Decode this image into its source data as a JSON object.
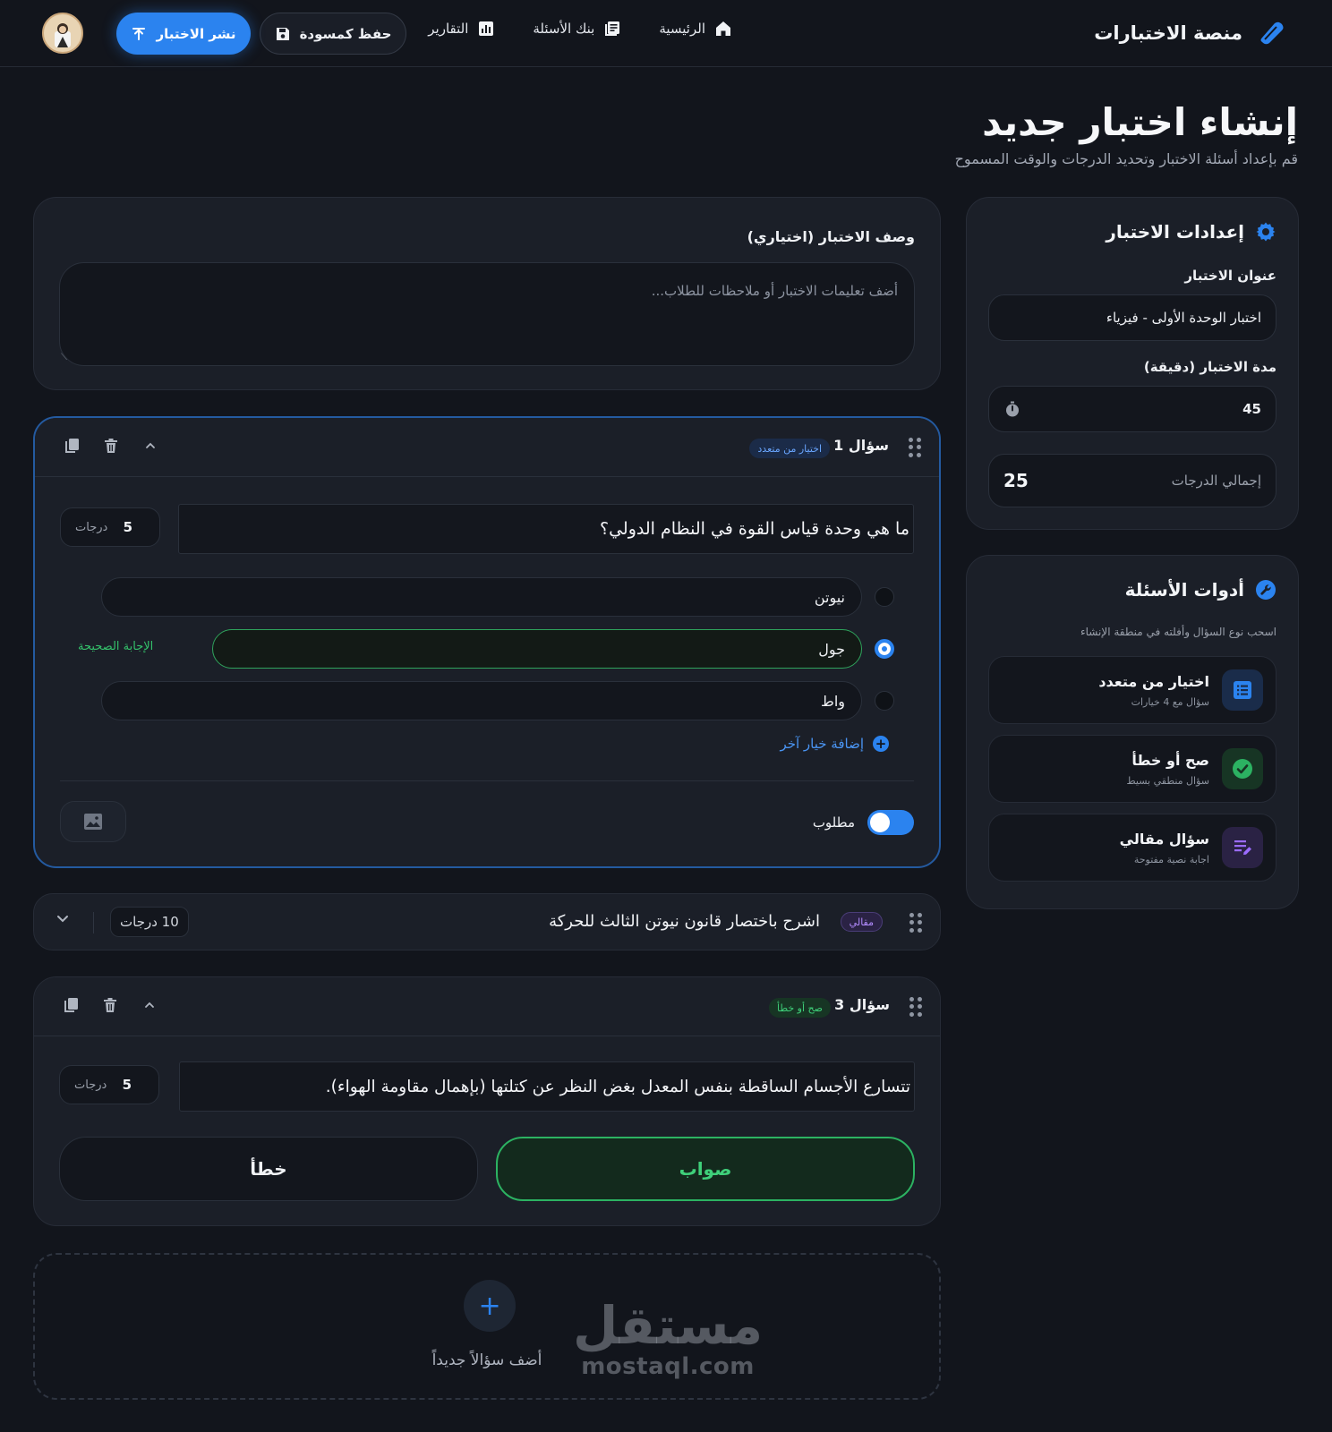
{
  "nav": {
    "brand": "منصة الاختبارات",
    "links": [
      {
        "label": "الرئيسية",
        "icon": "home-icon"
      },
      {
        "label": "بنك الأسئلة",
        "icon": "question-bank-icon"
      },
      {
        "label": "التقارير",
        "icon": "reports-icon"
      }
    ],
    "save_draft": "حفظ كمسودة",
    "publish": "نشر الاختبار"
  },
  "header": {
    "title": "إنشاء اختبار جديد",
    "subtitle": "قم بإعداد أسئلة الاختبار وتحديد الدرجات والوقت المسموح"
  },
  "description": {
    "label": "وصف الاختبار (اختياري)",
    "placeholder": "أضف تعليمات الاختبار أو ملاحظات للطلاب..."
  },
  "questions": [
    {
      "title": "سؤال 1",
      "type_badge": "اختيار من متعدد",
      "text": "ما هي وحدة قياس القوة في النظام الدولي؟",
      "score": "5",
      "score_unit": "درجات",
      "options": [
        {
          "label": "نيوتن",
          "correct": false
        },
        {
          "label": "جول",
          "correct": true
        },
        {
          "label": "واط",
          "correct": false
        }
      ],
      "correct_tag": "الإجابة الصحيحة",
      "add_option": "إضافة خيار آخر",
      "required_label": "مطلوب",
      "required": true
    },
    {
      "type_badge": "مقالي",
      "text": "اشرح باختصار قانون نيوتن الثالث للحركة",
      "score_label": "10 درجات"
    },
    {
      "title": "سؤال 3",
      "type_badge": "صح أو خطأ",
      "text": "تتسارع الأجسام الساقطة بنفس المعدل بغض النظر عن كتلتها (بإهمال مقاومة الهواء).",
      "score": "5",
      "score_unit": "درجات",
      "true_label": "صواب",
      "false_label": "خطأ",
      "selected": "true"
    }
  ],
  "add_question": "أضف سؤالاً جديداً",
  "settings": {
    "heading": "إعدادات الاختبار",
    "title_label": "عنوان الاختبار",
    "title_value": "اختبار الوحدة الأولى - فيزياء",
    "duration_label": "مدة الاختبار (دقيقة)",
    "duration_value": "45",
    "total_label": "إجمالي الدرجات",
    "total_value": "25"
  },
  "tools": {
    "heading": "أدوات الأسئلة",
    "hint": "اسحب نوع السؤال وأفلته في منطقة الإنشاء",
    "items": [
      {
        "name": "اختيار من متعدد",
        "desc": "سؤال مع 4 خيارات",
        "icon": "list-icon",
        "color": "#2b83ef"
      },
      {
        "name": "صح أو خطأ",
        "desc": "سؤال منطقي بسيط",
        "icon": "check-circle-icon",
        "color": "#2cb262"
      },
      {
        "name": "سؤال مقالي",
        "desc": "اجابة نصية مفتوحة",
        "icon": "edit-text-icon",
        "color": "#9b6cff"
      }
    ]
  },
  "watermark": {
    "ar": "مستقل",
    "en": "mostaql.com"
  }
}
